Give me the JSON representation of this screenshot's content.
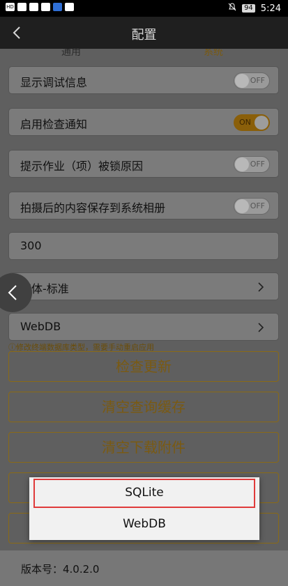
{
  "status_bar": {
    "time": "5:24",
    "battery": "94"
  },
  "header": {
    "title": "配置"
  },
  "tabs": [
    {
      "label": "通用"
    },
    {
      "label": "系统"
    }
  ],
  "settings": [
    {
      "label": "显示调试信息",
      "toggle": "OFF"
    },
    {
      "label": "启用检查通知",
      "toggle": "ON"
    },
    {
      "label": "提示作业（项）被锁原因",
      "toggle": "OFF"
    },
    {
      "label": "拍摄后的内容保存到系统相册",
      "toggle": "OFF"
    },
    {
      "label": "300"
    },
    {
      "label": "字体-标准"
    },
    {
      "label": "WebDB"
    }
  ],
  "note": "ⓘ修改终端数据库类型，需要手动重启应用",
  "buttons": [
    {
      "label": "检查更新"
    },
    {
      "label": "清空查询缓存"
    },
    {
      "label": "清空下载附件"
    }
  ],
  "version": {
    "label": "版本号：4.0.2.0"
  },
  "dialog": {
    "options": [
      {
        "label": "SQLite"
      },
      {
        "label": "WebDB"
      }
    ]
  },
  "colors": {
    "accent": "#f0a100",
    "highlight": "#e03a3a"
  }
}
